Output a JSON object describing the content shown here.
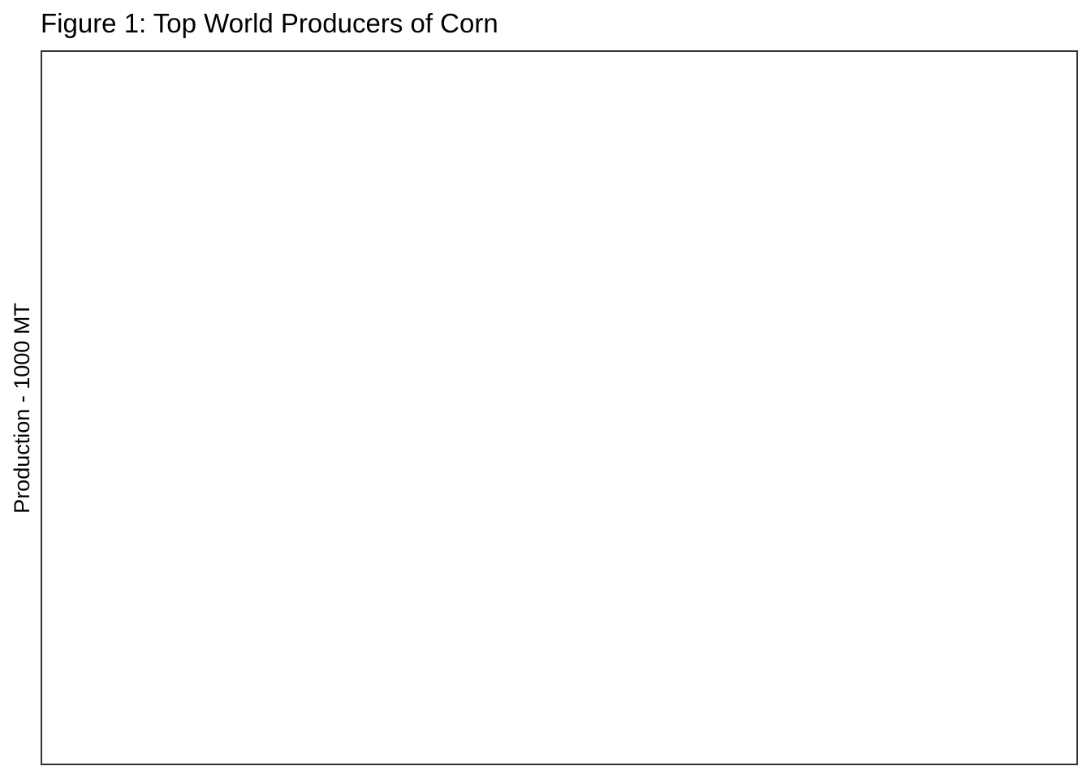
{
  "chart_data": {
    "type": "bar",
    "title": "Figure 1: Top World Producers of Corn",
    "xlabel": "",
    "ylabel": "Production - 1000 MT",
    "categories": [],
    "series": [],
    "grid": false,
    "legend": "none"
  },
  "colors": {
    "background": "#ffffff",
    "panel_border": "#333333",
    "text": "#000000"
  }
}
